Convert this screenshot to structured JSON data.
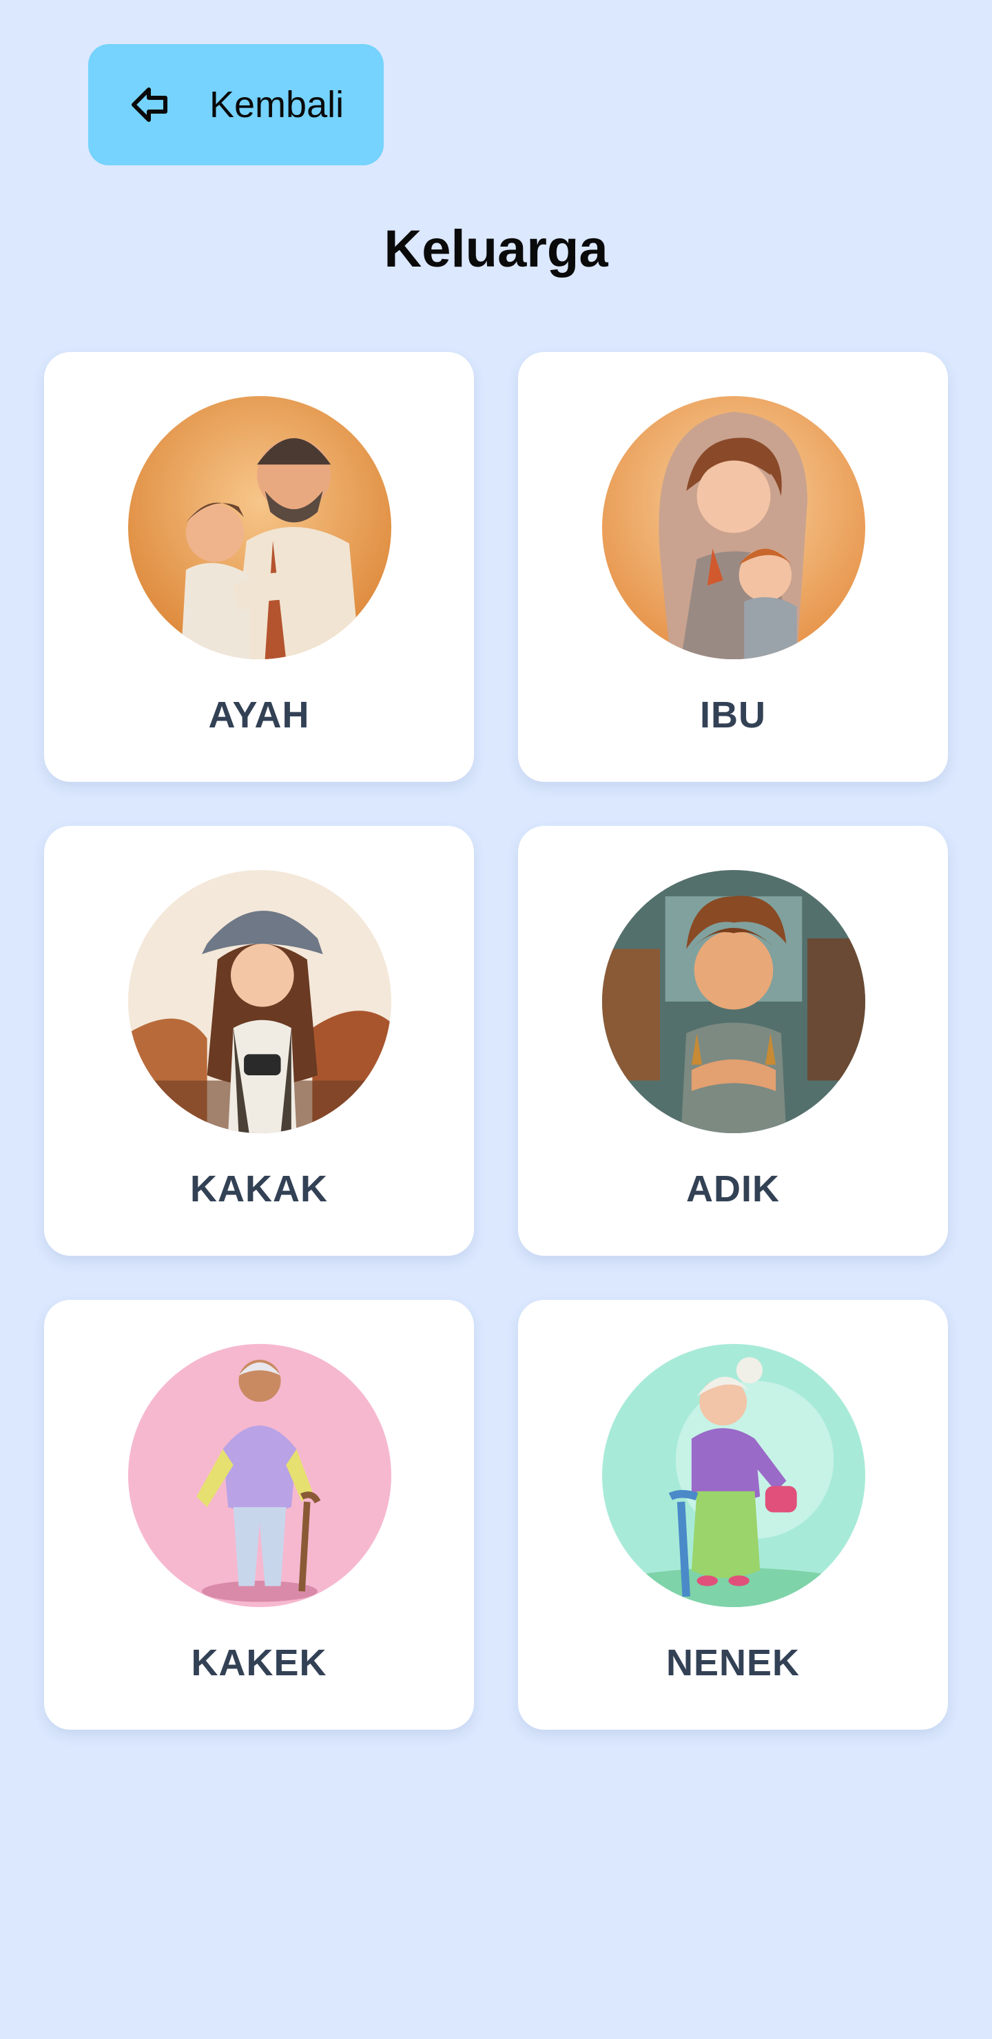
{
  "header": {
    "back_label": "Kembali",
    "back_icon": "arrow-left-icon"
  },
  "page": {
    "title": "Keluarga"
  },
  "cards": [
    {
      "label": "AYAH",
      "image": "father-hugging-child-illustration",
      "bg": "#f0a45a"
    },
    {
      "label": "IBU",
      "image": "mother-holding-baby-illustration",
      "bg": "#f2b46e"
    },
    {
      "label": "KAKAK",
      "image": "older-sister-illustration",
      "bg": "#f3e6d6"
    },
    {
      "label": "ADIK",
      "image": "younger-brother-illustration",
      "bg": "#5b7a78"
    },
    {
      "label": "KAKEK",
      "image": "grandfather-illustration",
      "bg": "#f6b8cf"
    },
    {
      "label": "NENEK",
      "image": "grandmother-illustration",
      "bg": "#a8ead8"
    }
  ],
  "colors": {
    "background": "#dbe8fe",
    "back_button": "#75d3fd",
    "card": "#ffffff",
    "label_text": "#334155"
  }
}
